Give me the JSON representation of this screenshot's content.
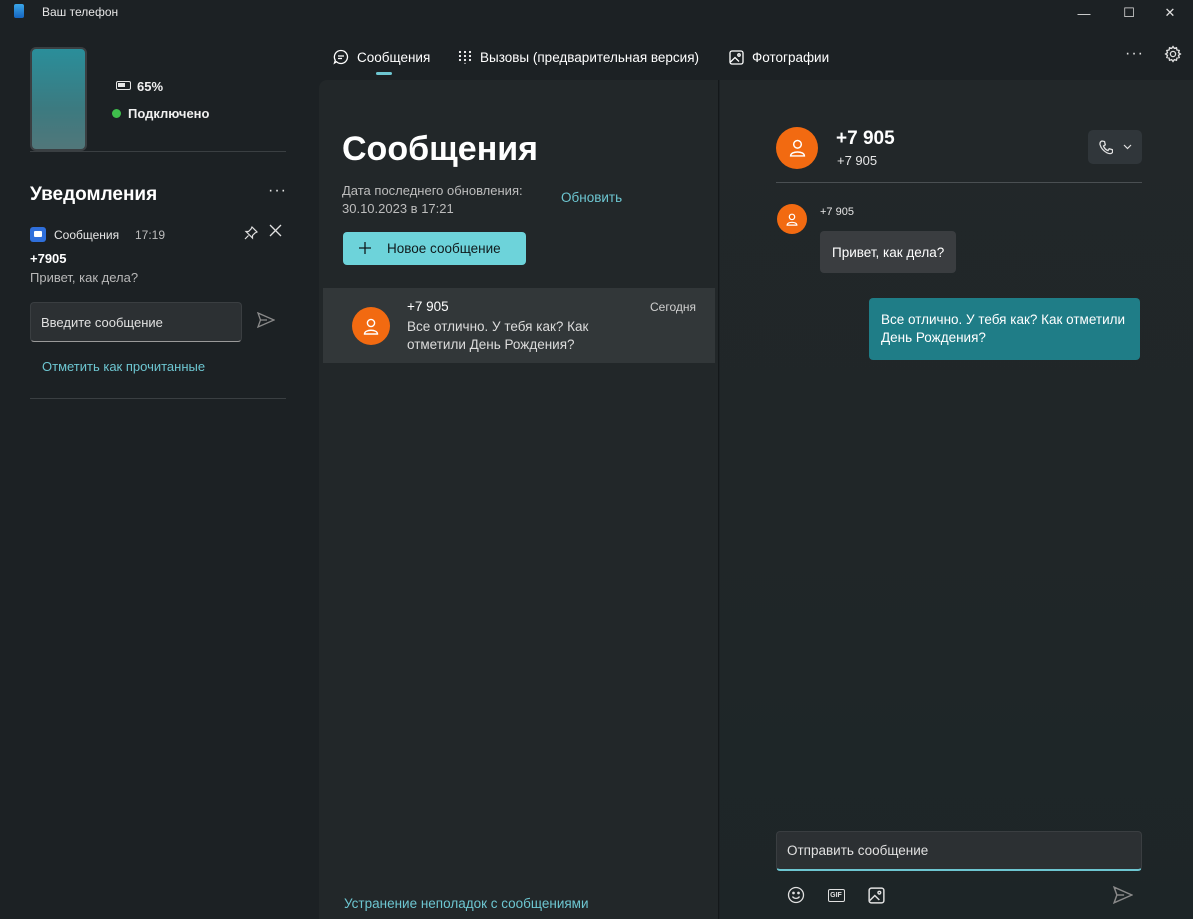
{
  "window": {
    "title": "Ваш телефон",
    "minimize": "—",
    "maximize": "☐",
    "close": "✕"
  },
  "phone": {
    "battery": "65%",
    "status": "Подключено",
    "status_color": "#3fbf4c"
  },
  "notifications": {
    "title": "Уведомления",
    "more": "···",
    "item": {
      "app": "Сообщения",
      "time": "17:19",
      "sender": "+7905",
      "body": "Привет, как дела?",
      "reply_placeholder": "Введите сообщение",
      "mark_read": "Отметить как прочитанные"
    }
  },
  "tabs": [
    {
      "label": "Сообщения",
      "icon": "message-icon",
      "active": true
    },
    {
      "label": "Вызовы (предварительная версия)",
      "icon": "dialpad-icon"
    },
    {
      "label": "Фотографии",
      "icon": "photo-icon"
    }
  ],
  "toolbar": {
    "more": "···"
  },
  "messages_panel": {
    "title": "Сообщения",
    "updated_label": "Дата последнего обновления: 30.10.2023 в 17:21",
    "refresh": "Обновить",
    "new_message": "Новое сообщение",
    "conversations": [
      {
        "name": "+7 905",
        "preview": "Все отлично. У тебя как? Как отметили День Рождения?",
        "date": "Сегодня"
      }
    ],
    "troubleshoot": "Устранение неполадок с сообщениями"
  },
  "chat": {
    "name": "+7 905",
    "subtitle": "+7 905",
    "incoming_sender": "+7 905",
    "incoming": "Привет, как дела?",
    "outgoing": "Все отлично. У тебя как? Как отметили День Рождения?",
    "input_placeholder": "Отправить сообщение",
    "gif_label": "GIF"
  },
  "colors": {
    "accent": "#6dc6d1",
    "avatar": "#f26a11",
    "outgoing_bubble": "#1f7d87"
  }
}
